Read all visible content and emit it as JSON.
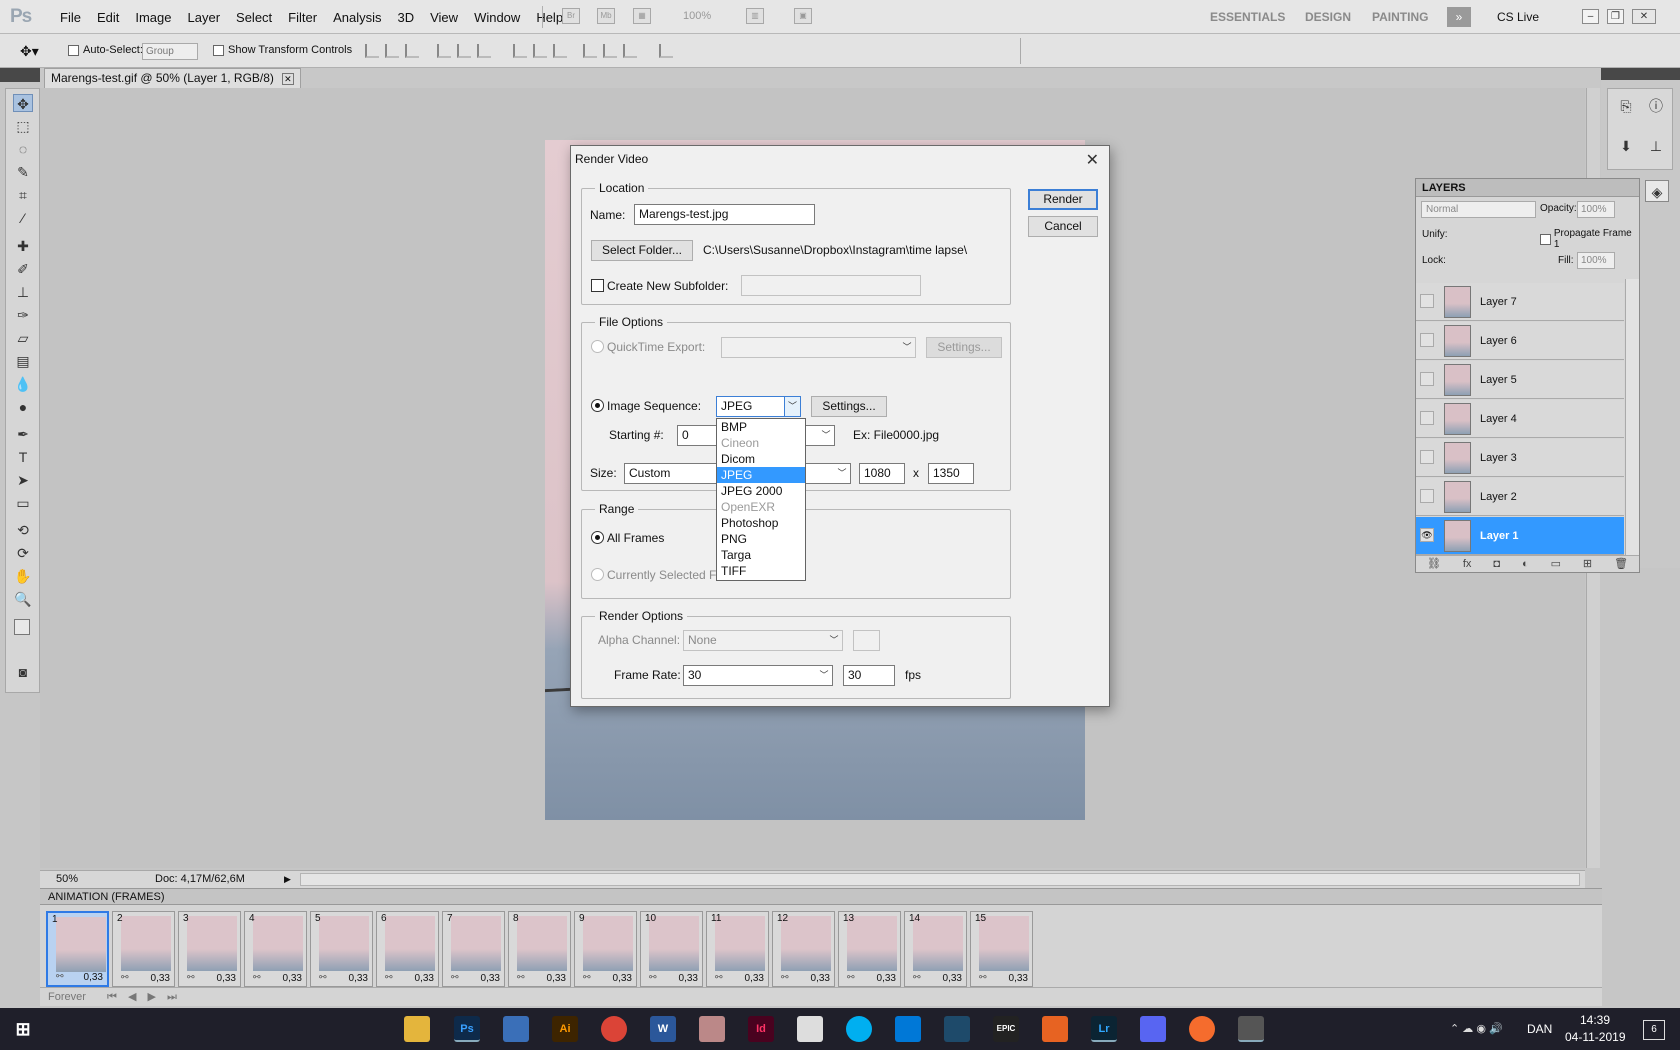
{
  "app": {
    "logo": "Ps"
  },
  "menu": [
    "File",
    "Edit",
    "Image",
    "Layer",
    "Select",
    "Filter",
    "Analysis",
    "3D",
    "View",
    "Window",
    "Help"
  ],
  "menubar": {
    "zoom": "100%",
    "workspaces": [
      "ESSENTIALS",
      "DESIGN",
      "PAINTING"
    ],
    "cslive": "CS Live"
  },
  "options": {
    "auto_select": "Auto-Select:",
    "auto_select_value": "Group",
    "transform": "Show Transform Controls"
  },
  "document": {
    "tab": "Marengs-test.gif @ 50% (Layer 1, RGB/8)"
  },
  "status": {
    "zoom": "50%",
    "doc": "Doc: 4,17M/62,6M"
  },
  "dialog": {
    "title": "Render Video",
    "render": "Render",
    "cancel": "Cancel",
    "location": {
      "legend": "Location",
      "name_label": "Name:",
      "name_value": "Marengs-test.jpg",
      "select_folder": "Select Folder...",
      "path": "C:\\Users\\Susanne\\Dropbox\\Instagram\\time lapse\\",
      "subfolder": "Create New Subfolder:"
    },
    "file_options": {
      "legend": "File Options",
      "quicktime": "QuickTime Export:",
      "settings": "Settings...",
      "image_sequence": "Image Sequence:",
      "format": "JPEG",
      "settings2": "Settings...",
      "starting_label": "Starting #:",
      "starting_value": "0",
      "example": "Ex: File0000.jpg",
      "size_label": "Size:",
      "size_value": "Custom",
      "width": "1080",
      "x": "x",
      "height": "1350"
    },
    "range": {
      "legend": "Range",
      "all": "All Frames",
      "current": "Currently Selected F"
    },
    "render_options": {
      "legend": "Render Options",
      "alpha_label": "Alpha Channel:",
      "alpha_value": "None",
      "rate_label": "Frame Rate:",
      "rate_value": "30",
      "rate_input": "30",
      "fps": "fps"
    },
    "format_list": [
      {
        "label": "BMP",
        "state": "normal"
      },
      {
        "label": "Cineon",
        "state": "disabled"
      },
      {
        "label": "Dicom",
        "state": "normal"
      },
      {
        "label": "JPEG",
        "state": "selected"
      },
      {
        "label": "JPEG 2000",
        "state": "normal"
      },
      {
        "label": "OpenEXR",
        "state": "disabled"
      },
      {
        "label": "Photoshop",
        "state": "normal"
      },
      {
        "label": "PNG",
        "state": "normal"
      },
      {
        "label": "Targa",
        "state": "normal"
      },
      {
        "label": "TIFF",
        "state": "normal"
      }
    ]
  },
  "layers": {
    "title": "LAYERS",
    "blend": "Normal",
    "opacity_label": "Opacity:",
    "opacity": "100%",
    "unify": "Unify:",
    "propagate": "Propagate Frame 1",
    "lock": "Lock:",
    "fill_label": "Fill:",
    "fill": "100%",
    "items": [
      "Layer 7",
      "Layer 6",
      "Layer 5",
      "Layer 4",
      "Layer 3",
      "Layer 2",
      "Layer 1"
    ],
    "selected": "Layer 1"
  },
  "animation": {
    "title": "ANIMATION (FRAMES)",
    "loop": "Forever",
    "frames": [
      {
        "n": "1",
        "t": "0,33"
      },
      {
        "n": "2",
        "t": "0,33"
      },
      {
        "n": "3",
        "t": "0,33"
      },
      {
        "n": "4",
        "t": "0,33"
      },
      {
        "n": "5",
        "t": "0,33"
      },
      {
        "n": "6",
        "t": "0,33"
      },
      {
        "n": "7",
        "t": "0,33"
      },
      {
        "n": "8",
        "t": "0,33"
      },
      {
        "n": "9",
        "t": "0,33"
      },
      {
        "n": "10",
        "t": "0,33"
      },
      {
        "n": "11",
        "t": "0,33"
      },
      {
        "n": "12",
        "t": "0,33"
      },
      {
        "n": "13",
        "t": "0,33"
      },
      {
        "n": "14",
        "t": "0,33"
      },
      {
        "n": "15",
        "t": "0,33"
      }
    ]
  },
  "taskbar": {
    "lang": "DAN",
    "time": "14:39",
    "date": "04-11-2019",
    "badge": "6",
    "apps": [
      "file-explorer",
      "Ps",
      "store",
      "Ai",
      "chrome",
      "W",
      "paint",
      "Id",
      "mail",
      "skype",
      "edge",
      "photos",
      "EPIC",
      "ableton",
      "Lr",
      "discord",
      "origin",
      "photo-viewer"
    ]
  }
}
